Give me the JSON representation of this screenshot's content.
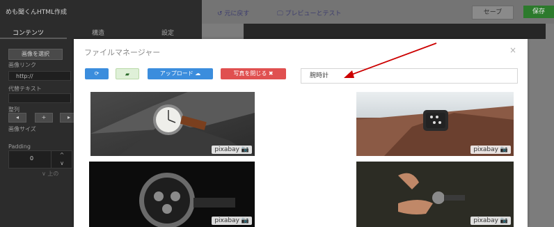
{
  "sidebar": {
    "title": "めも聞くんHTML作成",
    "tabs": [
      "コンテンツ",
      "構造",
      "設定"
    ],
    "select_image_label": "画像を選択",
    "image_link_label": "画像リンク",
    "image_link_value": "http://",
    "alt_text_label": "代替テキスト",
    "align_label": "整列",
    "image_size_label": "画像サイズ",
    "padding_label": "Padding",
    "padding_value": "0",
    "footer_text": "∨ 上の"
  },
  "topbar": {
    "undo_label": "元に戻す",
    "preview_label": "プレビューとテスト",
    "save_label": "セーブ",
    "publish_label": "保存"
  },
  "modal": {
    "title": "ファイルマネージャー",
    "close": "×",
    "upload_label": "アップロード ☁",
    "close_photos_label": "写真を閉じる ✖",
    "search_value": "腕時計",
    "watermark": "pixabay 📷",
    "colors": {
      "refresh": "#3b8ddd",
      "folder": "#dff0d8",
      "upload": "#3b8ddd",
      "close_photos": "#e05050",
      "annotation": "#cc0000"
    }
  }
}
